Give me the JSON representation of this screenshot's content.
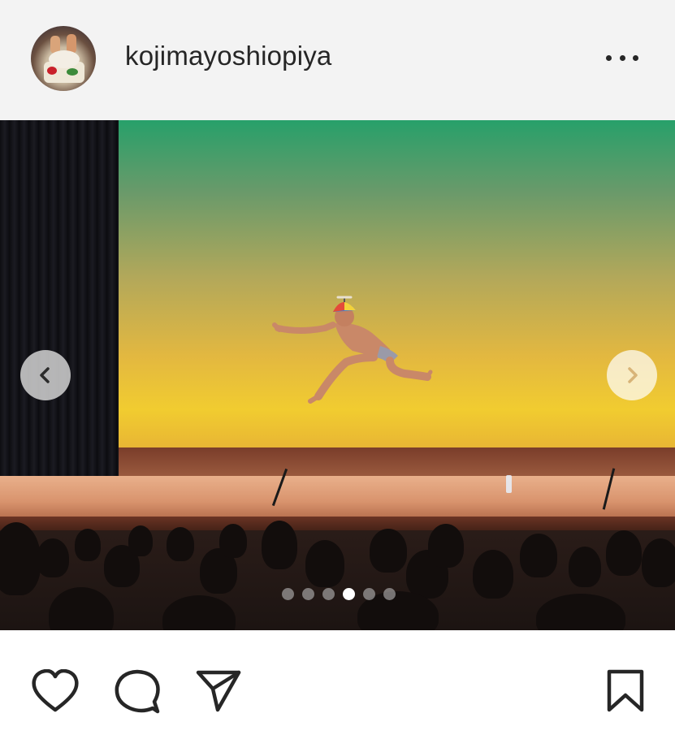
{
  "post": {
    "username": "kojimayoshiopiya",
    "carousel": {
      "total_slides": 6,
      "active_index": 3
    }
  },
  "icons": {
    "more": "more-horizontal-icon",
    "prev": "chevron-left-icon",
    "next": "chevron-right-icon",
    "like": "heart-icon",
    "comment": "comment-icon",
    "share": "paper-plane-icon",
    "save": "bookmark-icon"
  },
  "colors": {
    "header_bg": "#f3f3f3",
    "text": "#262626",
    "dot_active": "#ffffff"
  }
}
